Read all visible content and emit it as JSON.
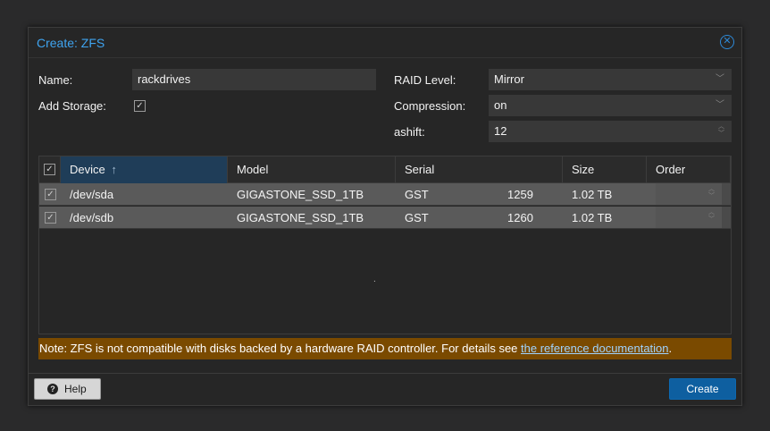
{
  "dialog": {
    "title": "Create: ZFS",
    "close_icon": "close-icon"
  },
  "form": {
    "name_label": "Name:",
    "name_value": "rackdrives",
    "add_storage_label": "Add Storage:",
    "add_storage_checked": true,
    "raid_label": "RAID Level:",
    "raid_value": "Mirror",
    "compression_label": "Compression:",
    "compression_value": "on",
    "ashift_label": "ashift:",
    "ashift_value": "12"
  },
  "grid": {
    "columns": [
      "Device",
      "Model",
      "Serial",
      "Size",
      "Order"
    ],
    "sort_indicator": "↑",
    "rows": [
      {
        "device": "/dev/sda",
        "model": "GIGASTONE_SSD_1TB",
        "serial_prefix": "GST",
        "serial_suffix": "1259",
        "size": "1.02 TB",
        "order": "",
        "checked": true
      },
      {
        "device": "/dev/sdb",
        "model": "GIGASTONE_SSD_1TB",
        "serial_prefix": "GST",
        "serial_suffix": "1260",
        "size": "1.02 TB",
        "order": "",
        "checked": true
      }
    ],
    "empty_marker": "."
  },
  "note": {
    "text": "Note: ZFS is not compatible with disks backed by a hardware RAID controller. For details see ",
    "link": "the reference documentation",
    "suffix": "."
  },
  "footer": {
    "help_label": "Help",
    "create_label": "Create"
  },
  "colors": {
    "accent": "#3fa4f0",
    "primary_button": "#0e5fa0",
    "note_bg": "#7a4a00",
    "selected_row": "#5a5a5a"
  }
}
